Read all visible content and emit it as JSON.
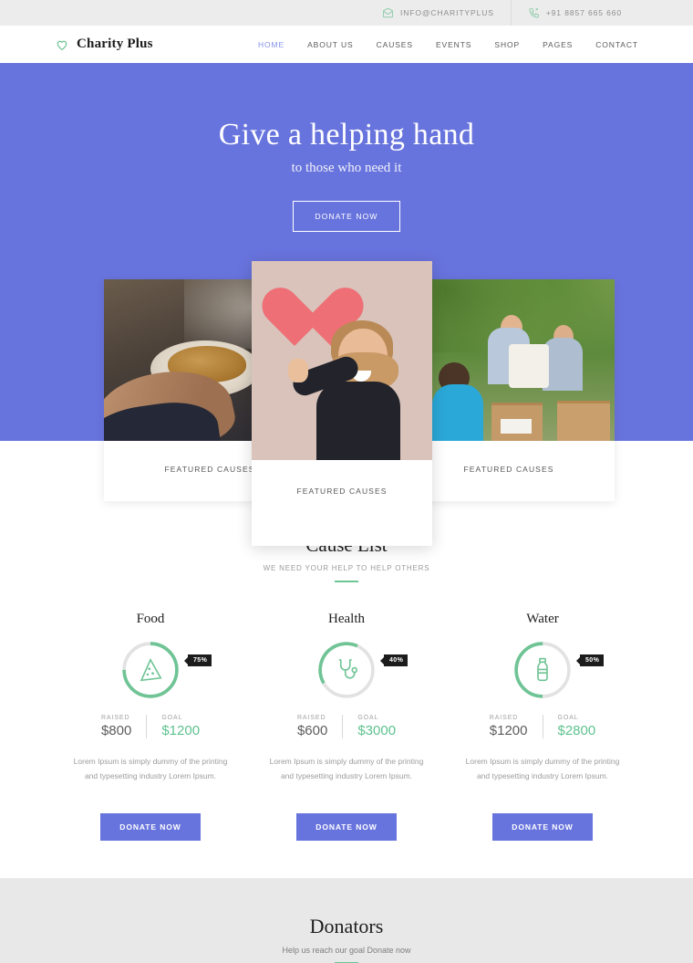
{
  "topbar": {
    "email": "INFO@CHARITYPLUS",
    "email_icon": "envelope-icon",
    "phone": "+91 8857 665 660",
    "phone_icon": "phone-icon"
  },
  "header": {
    "brand": "Charity Plus",
    "brand_icon": "heart-icon",
    "nav": [
      {
        "label": "HOME",
        "active": true
      },
      {
        "label": "ABOUT US",
        "active": false
      },
      {
        "label": "CAUSES",
        "active": false
      },
      {
        "label": "EVENTS",
        "active": false
      },
      {
        "label": "SHOP",
        "active": false
      },
      {
        "label": "PAGES",
        "active": false
      },
      {
        "label": "CONTACT",
        "active": false
      }
    ]
  },
  "hero": {
    "title": "Give a helping hand",
    "subtitle": "to those who need it",
    "cta": "DONATE NOW",
    "bg_color": "#6874dd"
  },
  "featured": {
    "cards": [
      {
        "label": "FEATURED CAUSES",
        "image": "soup-kitchen-photo"
      },
      {
        "label": "FEATURED CAUSES",
        "image": "girl-with-heart-photo"
      },
      {
        "label": "FEATURED CAUSES",
        "image": "volunteers-with-boxes-photo"
      }
    ]
  },
  "cause_list": {
    "title": "Cause List",
    "subtitle": "WE NEED YOUR HELP TO HELP OTHERS",
    "raised_label": "RAISED",
    "goal_label": "GOAL",
    "donate_label": "DONATE NOW",
    "description": "Lorem Ipsum is simply dummy of the printing and typesetting industry Lorem Ipsum.",
    "accent_green": "#6fc495",
    "accent_purple": "#6874dd",
    "items": [
      {
        "title": "Food",
        "icon": "pizza-slice-icon",
        "percent": "75%",
        "percent_value": 75,
        "raised": "$800",
        "goal": "$1200"
      },
      {
        "title": "Health",
        "icon": "stethoscope-icon",
        "percent": "40%",
        "percent_value": 40,
        "raised": "$600",
        "goal": "$3000"
      },
      {
        "title": "Water",
        "icon": "water-bottle-icon",
        "percent": "50%",
        "percent_value": 50,
        "raised": "$1200",
        "goal": "$2800"
      }
    ]
  },
  "donators": {
    "title": "Donators",
    "subtitle": "Help us reach our goal Donate now"
  }
}
